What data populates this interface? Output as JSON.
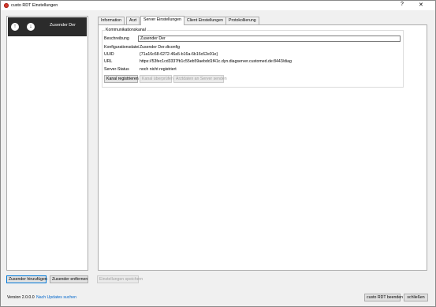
{
  "window": {
    "title": "custo RDT Einstellungen",
    "help": "?",
    "close": "✕"
  },
  "list": {
    "selected_item": {
      "label": "Zusender Der",
      "up_icon": "arrow-up-icon",
      "down_icon": "arrow-down-icon"
    }
  },
  "tabs": [
    {
      "label": "Information"
    },
    {
      "label": "Arzt"
    },
    {
      "label": "Server Einstellungen",
      "active": true
    },
    {
      "label": "Client Einstellungen"
    },
    {
      "label": "Protokollierung"
    }
  ],
  "server": {
    "group_label": "Kommunikationskanal",
    "rows": [
      {
        "label": "Beschreibung",
        "value": "Zusender Der"
      },
      {
        "label": "Konfigurationsdatei",
        "value": "Zusender Der.dtconfig"
      },
      {
        "label": "UUID",
        "value": "{71a16c68-6272-46a5-b16a-6b16c62e91e}"
      },
      {
        "label": "URL",
        "value": "https://53fec1cd3337fb1c55eb59aebdd1f41c.dyn.diagserver.customed.de:8443/diag"
      },
      {
        "label": "Server-Status",
        "value": "noch nicht registriert"
      }
    ],
    "buttons": {
      "register": "Kanal registrieren",
      "check": "Kanal überprüfen",
      "send": "Arztdaten an Server senden"
    }
  },
  "footer": {
    "add": "Zusender hinzufügen",
    "remove": "Zusender entfernen",
    "save": "Einstellungen speichern",
    "version": "Version 2.0.0.0",
    "updates_link": "Nach Updates suchen",
    "quit": "custo RDT beenden",
    "close": "schließen"
  },
  "colors": {
    "selection": "#2b2b2b",
    "link": "#0066cc",
    "focus": "#0078d7"
  }
}
